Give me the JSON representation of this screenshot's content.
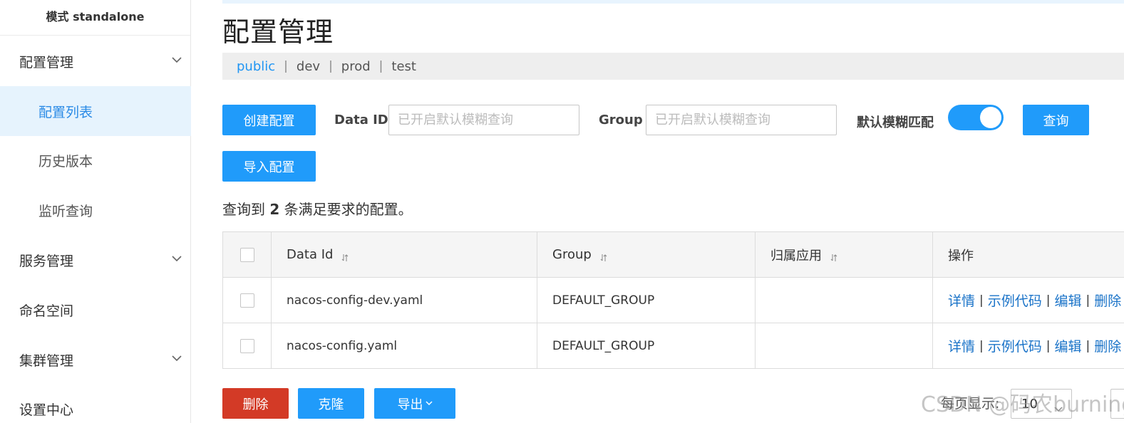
{
  "sidebar": {
    "mode_label": "模式 standalone",
    "items": [
      {
        "label": "配置管理",
        "expandable": true
      },
      {
        "label": "配置列表",
        "active": true
      },
      {
        "label": "历史版本"
      },
      {
        "label": "监听查询"
      },
      {
        "label": "服务管理",
        "expandable": true
      },
      {
        "label": "命名空间"
      },
      {
        "label": "集群管理",
        "expandable": true
      },
      {
        "label": "设置中心"
      }
    ]
  },
  "header": {
    "title": "配置管理"
  },
  "namespaces": {
    "items": [
      "public",
      "dev",
      "prod",
      "test"
    ],
    "separator": "|",
    "active": "public"
  },
  "toolbar": {
    "create_label": "创建配置",
    "import_label": "导入配置",
    "dataid_label": "Data ID",
    "dataid_placeholder": "已开启默认模糊查询",
    "group_label": "Group",
    "group_placeholder": "已开启默认模糊查询",
    "fuzzy_label": "默认模糊匹配",
    "fuzzy_on": true,
    "query_label": "查询"
  },
  "result": {
    "prefix": "查询到",
    "count": "2",
    "suffix": "条满足要求的配置。"
  },
  "table": {
    "columns": [
      "Data Id",
      "Group",
      "归属应用",
      "操作"
    ],
    "rows": [
      {
        "data_id": "nacos-config-dev.yaml",
        "group": "DEFAULT_GROUP",
        "app": ""
      },
      {
        "data_id": "nacos-config.yaml",
        "group": "DEFAULT_GROUP",
        "app": ""
      }
    ],
    "actions": {
      "detail": "详情",
      "sample": "示例代码",
      "edit": "编辑",
      "delete": "删除",
      "sep": "|"
    }
  },
  "bottom": {
    "delete_label": "删除",
    "clone_label": "克隆",
    "export_label": "导出",
    "per_page_label": "每页显示:",
    "page_size": "10"
  },
  "watermark": "CSDN @码农burning",
  "colors": {
    "primary": "#209bfa",
    "danger": "#d33a26",
    "link": "#1a73c8",
    "active_bg": "#e6f3fd"
  }
}
